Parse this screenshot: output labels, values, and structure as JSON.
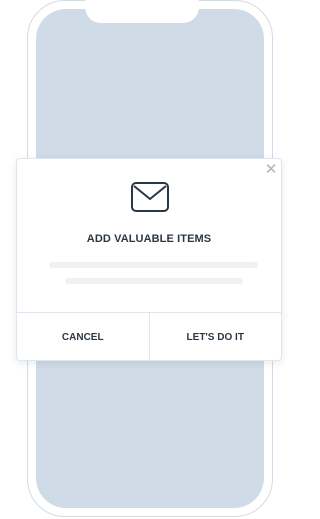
{
  "modal": {
    "close_icon": "close-icon",
    "icon": "envelope-icon",
    "title": "ADD VALUABLE ITEMS",
    "cancel_label": "CANCEL",
    "confirm_label": "LET'S DO IT"
  },
  "colors": {
    "screen_background": "#cfdbe6",
    "phone_outline": "#d4dbe3",
    "text": "#2c3744",
    "placeholder_lines": "#eef1f4"
  }
}
